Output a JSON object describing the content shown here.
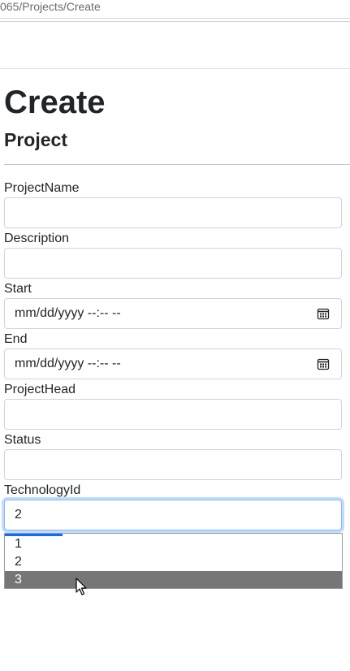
{
  "browser": {
    "url": "065/Projects/Create"
  },
  "page": {
    "title": "Create",
    "subtitle": "Project"
  },
  "form": {
    "project_name": {
      "label": "ProjectName",
      "value": ""
    },
    "description": {
      "label": "Description",
      "value": ""
    },
    "start": {
      "label": "Start",
      "value": "mm/dd/yyyy --:-- --",
      "icon": "calendar-icon"
    },
    "end": {
      "label": "End",
      "value": "mm/dd/yyyy --:-- --",
      "icon": "calendar-icon"
    },
    "project_head": {
      "label": "ProjectHead",
      "value": ""
    },
    "status": {
      "label": "Status",
      "value": ""
    },
    "technology_id": {
      "label": "TechnologyId",
      "value": "2",
      "options": [
        "1",
        "2",
        "3"
      ],
      "highlighted_option": "3"
    }
  },
  "colors": {
    "focus_border": "#86b7fe",
    "highlight": "#767676",
    "accent": "#0d6efd"
  }
}
